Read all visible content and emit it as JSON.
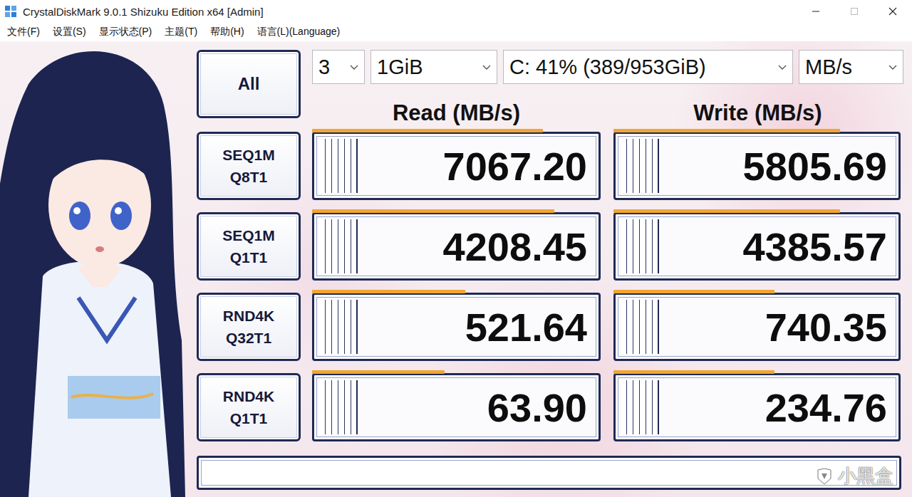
{
  "window": {
    "title": "CrystalDiskMark 9.0.1 Shizuku Edition x64 [Admin]"
  },
  "menu": [
    "文件(F)",
    "设置(S)",
    "显示状态(P)",
    "主题(T)",
    "帮助(H)",
    "语言(L)(Language)"
  ],
  "controls": {
    "all_button": "All",
    "count": "3",
    "size": "1GiB",
    "drive": "C: 41% (389/953GiB)",
    "unit": "MB/s"
  },
  "headers": {
    "read": "Read (MB/s)",
    "write": "Write (MB/s)"
  },
  "rows": [
    {
      "name": "SEQ1M",
      "params": "Q8T1",
      "read": {
        "value": "7067.20",
        "level": 0.8
      },
      "write": {
        "value": "5805.69",
        "level": 0.79
      }
    },
    {
      "name": "SEQ1M",
      "params": "Q1T1",
      "read": {
        "value": "4208.45",
        "level": 0.84
      },
      "write": {
        "value": "4385.57",
        "level": 0.79
      }
    },
    {
      "name": "RND4K",
      "params": "Q32T1",
      "read": {
        "value": "521.64",
        "level": 0.53
      },
      "write": {
        "value": "740.35",
        "level": 0.56
      }
    },
    {
      "name": "RND4K",
      "params": "Q1T1",
      "read": {
        "value": "63.90",
        "level": 0.46
      },
      "write": {
        "value": "234.76",
        "level": 0.56
      }
    }
  ],
  "watermark": "小黑盒"
}
